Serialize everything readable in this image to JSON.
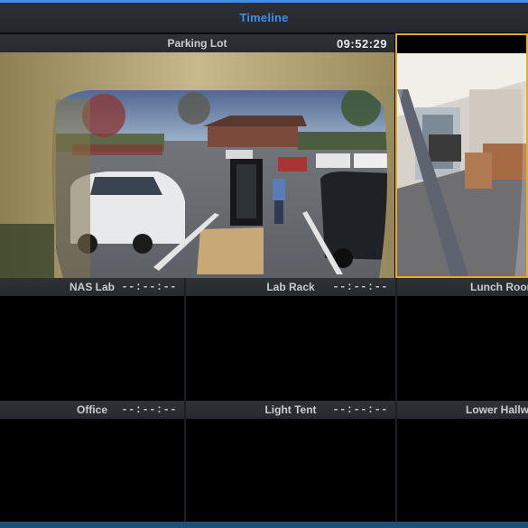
{
  "window": {
    "title": "Timeline"
  },
  "tiles": [
    {
      "name": "Parking Lot",
      "time": "09:52:29"
    },
    {
      "name": "",
      "time": ""
    },
    {
      "name": "NAS Lab",
      "time": "--:--:--"
    },
    {
      "name": "Lab Rack",
      "time": "--:--:--"
    },
    {
      "name": "Lunch Room",
      "time": ""
    },
    {
      "name": "Office",
      "time": "--:--:--"
    },
    {
      "name": "Light Tent",
      "time": "--:--:--"
    },
    {
      "name": "Lower Hallway",
      "time": ""
    }
  ],
  "colors": {
    "accent": "#3f8fe6",
    "selection": "#e3ad2b"
  }
}
